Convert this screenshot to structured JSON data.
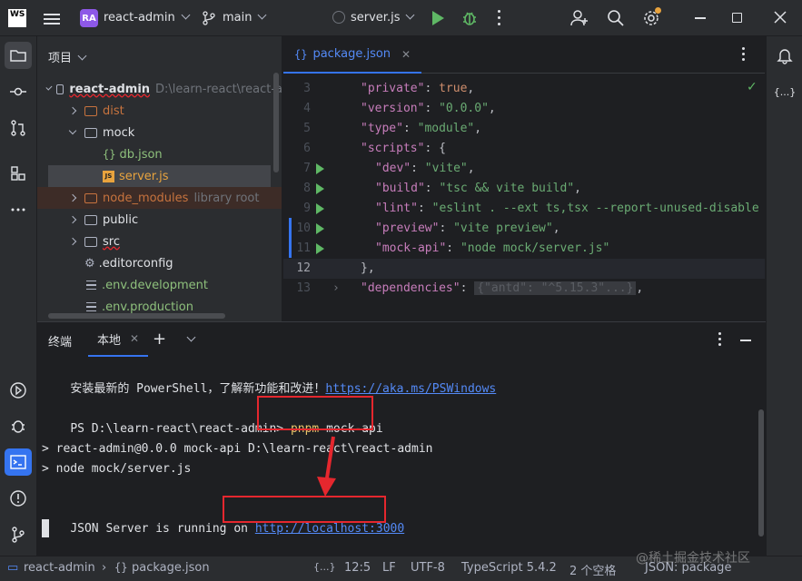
{
  "titlebar": {
    "logo_line1": "WS",
    "logo_line2": "",
    "project_badge": "RA",
    "project_name": "react-admin",
    "branch": "main",
    "run_config": "server.js"
  },
  "project_panel": {
    "title": "项目",
    "tree": [
      {
        "label": "react-admin",
        "extra": "D:\\learn-react\\react-a",
        "type": "folder-open"
      },
      {
        "label": "dist",
        "type": "folder-closed",
        "color": "#c7733e"
      },
      {
        "label": "mock",
        "type": "folder-open"
      },
      {
        "label": "db.json",
        "type": "json"
      },
      {
        "label": "server.js",
        "type": "js"
      },
      {
        "label": "node_modules",
        "extra": "library root",
        "type": "folder-closed",
        "color": "#c7733e"
      },
      {
        "label": "public",
        "type": "folder-closed"
      },
      {
        "label": "src",
        "type": "folder-closed"
      },
      {
        "label": ".editorconfig",
        "type": "config"
      },
      {
        "label": ".env.development",
        "type": "env"
      },
      {
        "label": ".env.production",
        "type": "env"
      }
    ]
  },
  "editor": {
    "tab_label": "package.json",
    "lines": [
      {
        "n": "3",
        "key": "\"private\"",
        "val": "true",
        "val_kind": "kw",
        "tail": ","
      },
      {
        "n": "4",
        "key": "\"version\"",
        "val": "\"0.0.0\"",
        "val_kind": "s",
        "tail": ","
      },
      {
        "n": "5",
        "key": "\"type\"",
        "val": "\"module\"",
        "val_kind": "s",
        "tail": ","
      },
      {
        "n": "6",
        "key": "\"scripts\"",
        "val": "{",
        "val_kind": "p",
        "tail": ""
      },
      {
        "n": "7",
        "key": "\"dev\"",
        "val": "\"vite\"",
        "val_kind": "s",
        "tail": ","
      },
      {
        "n": "8",
        "key": "\"build\"",
        "val": "\"tsc && vite build\"",
        "val_kind": "s",
        "tail": ","
      },
      {
        "n": "9",
        "key": "\"lint\"",
        "val": "\"eslint . --ext ts,tsx --report-unused-disable",
        "val_kind": "s",
        "tail": ""
      },
      {
        "n": "10",
        "key": "\"preview\"",
        "val": "\"vite preview\"",
        "val_kind": "s",
        "tail": ","
      },
      {
        "n": "11",
        "key": "\"mock-api\"",
        "val": "\"node mock/server.js\"",
        "val_kind": "s",
        "tail": ""
      },
      {
        "n": "12",
        "key": "",
        "val": "},",
        "val_kind": "p",
        "tail": ""
      },
      {
        "n": "13",
        "key": "\"dependencies\"",
        "val": "{\"antd\": \"^5.15.3\"...}",
        "val_kind": "fold",
        "tail": ","
      }
    ]
  },
  "terminal": {
    "title": "终端",
    "tab_label": "本地",
    "lines": [
      "安装最新的 PowerShell，了解新功能和改进！",
      "",
      "PS D:\\learn-react\\react-admin> ",
      "",
      "> react-admin@0.0.0 mock-api D:\\learn-react\\react-admin",
      "> node mock/server.js",
      "",
      "JSON Server is running on "
    ],
    "ps_link": "https://aka.ms/PSWindows",
    "command_pnpm": "pnpm",
    "command_rest": " mock-api",
    "server_url": "http://localhost:3000"
  },
  "statusbar": {
    "crumb_project": "react-admin",
    "crumb_file": "package.json",
    "braces": "{...}",
    "position": "12:5",
    "line_sep": "LF",
    "encoding": "UTF-8",
    "language": "TypeScript 5.4.2",
    "indent": "2 个空格",
    "schema": "JSON: package"
  },
  "watermark": "@稀土掘金技术社区"
}
